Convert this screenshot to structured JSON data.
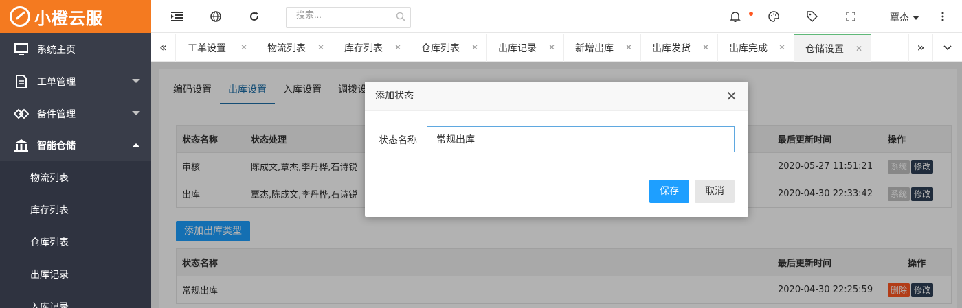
{
  "app": {
    "name": "小橙云服"
  },
  "sidebar": {
    "items": [
      {
        "label": "系统主页",
        "icon": "monitor-icon"
      },
      {
        "label": "工单管理",
        "icon": "document-icon"
      },
      {
        "label": "备件管理",
        "icon": "diamond-icon"
      },
      {
        "label": "智能仓储",
        "icon": "bank-icon"
      }
    ],
    "sub_items": [
      "物流列表",
      "库存列表",
      "仓库列表",
      "出库记录",
      "入库记录"
    ]
  },
  "topbar": {
    "search_placeholder": "搜索...",
    "user": "覃杰",
    "icons": [
      "menu-fold-icon",
      "globe-icon",
      "refresh-icon",
      "search-icon",
      "bell-icon",
      "theme-icon",
      "tag-icon",
      "fullscreen-icon",
      "more-icon"
    ]
  },
  "tabs": [
    {
      "label": "工单设置"
    },
    {
      "label": "物流列表"
    },
    {
      "label": "库存列表"
    },
    {
      "label": "仓库列表"
    },
    {
      "label": "出库记录"
    },
    {
      "label": "新增出库"
    },
    {
      "label": "出库发货"
    },
    {
      "label": "出库完成"
    },
    {
      "label": "仓储设置"
    }
  ],
  "subtabs": [
    "编码设置",
    "出库设置",
    "入库设置",
    "调拨设"
  ],
  "table1": {
    "headers": [
      "状态名称",
      "状态处理",
      "最后更新时间",
      "操作"
    ],
    "rows": [
      {
        "name": "审核",
        "handlers": "陈成文,覃杰,李丹桦,石诗锐",
        "updated": "2020-05-27 11:51:21",
        "btn1": "系统",
        "btn2": "修改"
      },
      {
        "name": "出库",
        "handlers": "覃杰,陈成文,李丹桦,石诗锐",
        "updated": "2020-04-30 22:33:42",
        "btn1": "系统",
        "btn2": "修改"
      }
    ]
  },
  "add_button": "添加出库类型",
  "table2": {
    "headers": [
      "状态名称",
      "最后更新时间",
      "操作"
    ],
    "rows": [
      {
        "name": "常规出库",
        "updated": "2020-04-30 22:25:59",
        "btn1": "删除",
        "btn2": "修改"
      }
    ]
  },
  "dialog": {
    "title": "添加状态",
    "label": "状态名称",
    "value": "常规出库",
    "save": "保存",
    "cancel": "取消"
  }
}
